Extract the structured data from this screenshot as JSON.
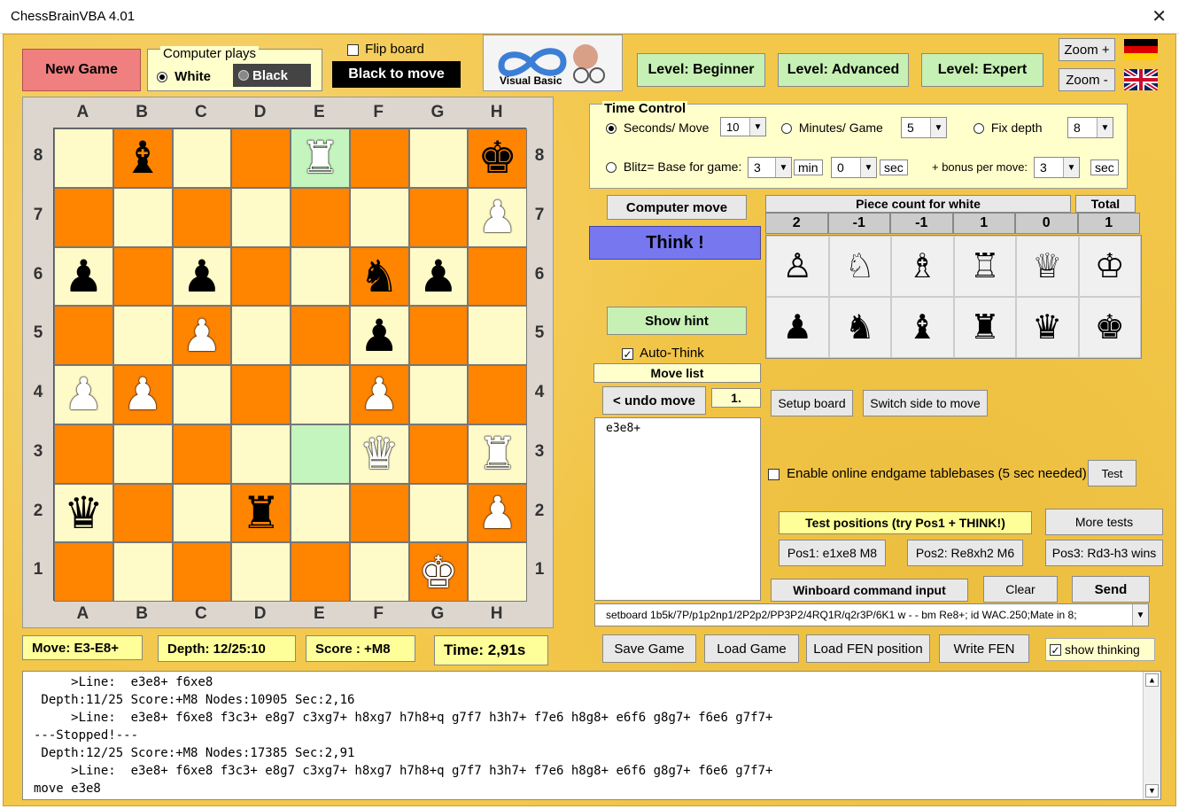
{
  "window": {
    "title": "ChessBrainVBA 4.01"
  },
  "top": {
    "new_game": "New Game",
    "computer_plays_label": "Computer plays",
    "white_label": "White",
    "black_label": "Black",
    "flip_board_label": "Flip board",
    "side_to_move": "Black to move",
    "logo_text": "Visual Basic",
    "level_beginner": "Level: Beginner",
    "level_advanced": "Level: Advanced",
    "level_expert": "Level: Expert",
    "zoom_plus": "Zoom +",
    "zoom_minus": "Zoom -"
  },
  "board": {
    "files": [
      "A",
      "B",
      "C",
      "D",
      "E",
      "F",
      "G",
      "H"
    ],
    "ranks": [
      "8",
      "7",
      "6",
      "5",
      "4",
      "3",
      "2",
      "1"
    ],
    "squares": [
      [
        "",
        "bB",
        "",
        "",
        "wR",
        "",
        "",
        "bK"
      ],
      [
        "",
        "",
        "",
        "",
        "",
        "",
        "",
        "wP"
      ],
      [
        "bP",
        "",
        "bP",
        "",
        "",
        "bN",
        "bP",
        ""
      ],
      [
        "",
        "",
        "wP",
        "",
        "",
        "bP",
        "",
        ""
      ],
      [
        "wP",
        "wP",
        "",
        "",
        "",
        "wP",
        "",
        ""
      ],
      [
        "",
        "",
        "",
        "",
        "",
        "wQ",
        "",
        "wR"
      ],
      [
        "bQ",
        "",
        "",
        "bR",
        "",
        "",
        "",
        "wP"
      ],
      [
        "",
        "",
        "",
        "",
        "",
        "",
        "wK",
        ""
      ]
    ],
    "highlight": [
      "e8",
      "e3"
    ]
  },
  "time_control": {
    "title": "Time Control",
    "seconds_move_label": "Seconds/ Move",
    "seconds_move_value": "10",
    "minutes_game_label": "Minutes/ Game",
    "minutes_game_value": "5",
    "fix_depth_label": "Fix depth",
    "fix_depth_value": "8",
    "blitz_label": "Blitz= Base for game:",
    "blitz_min_value": "3",
    "min_label": "min",
    "blitz_sec_value": "0",
    "sec_label": "sec",
    "bonus_label": "+ bonus per move:",
    "bonus_value": "3",
    "bonus_sec_label": "sec"
  },
  "controls": {
    "computer_move": "Computer move",
    "think": "Think !",
    "show_hint": "Show hint",
    "auto_think": "Auto-Think",
    "move_list_label": "Move list",
    "undo_move": "< undo move",
    "move_number": "1.",
    "move_list_text": "e3e8+",
    "setup_board": "Setup board",
    "switch_side": "Switch side to move",
    "tablebase_label": "Enable online endgame tablebases (5 sec needed)",
    "test": "Test",
    "test_positions_label": "Test positions (try Pos1 + THINK!)",
    "more_tests": "More tests",
    "pos1": "Pos1: e1xe8 M8",
    "pos2": "Pos2: Re8xh2 M6",
    "pos3": "Pos3: Rd3-h3 wins",
    "winboard_label": "Winboard command input",
    "clear": "Clear",
    "send": "Send",
    "command_input": "setboard 1b5k/7P/p1p2np1/2P2p2/PP3P2/4RQ1R/q2r3P/6K1 w - - bm Re8+; id WAC.250;Mate in 8;",
    "save_game": "Save Game",
    "load_game": "Load Game",
    "load_fen": "Load FEN position",
    "write_fen": "Write FEN",
    "show_thinking": "show thinking"
  },
  "piece_count": {
    "title": "Piece count for white",
    "total_label": "Total",
    "counts": [
      "2",
      "-1",
      "-1",
      "1",
      "0",
      "1"
    ],
    "white_pieces": [
      "♙",
      "♘",
      "♗",
      "♖",
      "♕",
      "♔"
    ],
    "black_pieces": [
      "♟",
      "♞",
      "♝",
      "♜",
      "♛",
      "♚"
    ]
  },
  "status": {
    "move": "Move: E3-E8+",
    "depth": "Depth: 12/25:10",
    "score": "Score : +M8",
    "time": "Time: 2,91s"
  },
  "console": {
    "lines": [
      "     >Line:  e3e8+ f6xe8",
      " Depth:11/25 Score:+M8 Nodes:10905 Sec:2,16",
      "     >Line:  e3e8+ f6xe8 f3c3+ e8g7 c3xg7+ h8xg7 h7h8+q g7f7 h3h7+ f7e6 h8g8+ e6f6 g8g7+ f6e6 g7f7+",
      "---Stopped!---",
      " Depth:12/25 Score:+M8 Nodes:17385 Sec:2,91",
      "     >Line:  e3e8+ f6xe8 f3c3+ e8g7 c3xg7+ h8xg7 h7h8+q g7f7 h3h7+ f7e6 h8g8+ e6f6 g8g7+ f6e6 g7f7+",
      "move e3e8"
    ]
  }
}
